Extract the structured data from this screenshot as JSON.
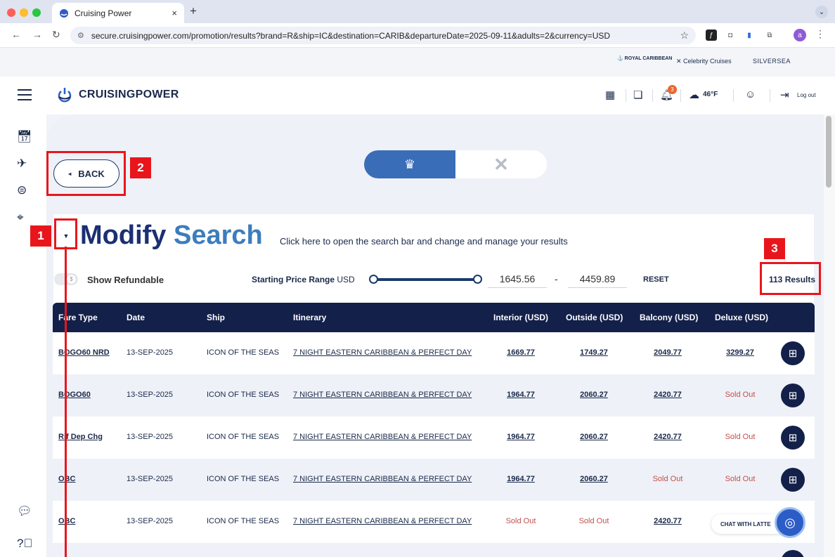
{
  "browser": {
    "tab_title": "Cruising Power",
    "tab_close": "×",
    "new_tab": "+",
    "tab_menu": "⌄",
    "url": "secure.cruisingpower.com/promotion/results?brand=R&ship=IC&destination=CARIB&departureDate=2025-09-11&adults=2&currency=USD",
    "profile_initial": "a"
  },
  "brands": [
    "ROYAL CARIBBEAN",
    "Celebrity Cruises",
    "SILVERSEA"
  ],
  "header": {
    "logo_text": "CRUISINGPOWER",
    "notification_count": "3",
    "temperature": "46°F",
    "logout_label": "Log out"
  },
  "back_button": {
    "label": "BACK"
  },
  "modify_search": {
    "title_part1": "Modify",
    "title_part2": "Search",
    "hint": "Click here to open the search bar and change and manage your results"
  },
  "filters": {
    "refundable_label": "Show Refundable",
    "price_label": "Starting Price Range",
    "price_currency": "USD",
    "price_min": "1645.56",
    "price_separator": "-",
    "price_max": "4459.89",
    "reset_label": "RESET",
    "results_count": "113 Results"
  },
  "table": {
    "headers": [
      "Fare Type",
      "Date",
      "Ship",
      "Itinerary",
      "Interior (USD)",
      "Outside (USD)",
      "Balcony (USD)",
      "Deluxe (USD)"
    ],
    "rows": [
      {
        "fare": "BOGO60 NRD",
        "date": "13-SEP-2025",
        "ship": "ICON OF THE SEAS",
        "itinerary": "7 NIGHT EASTERN CARIBBEAN & PERFECT DAY",
        "interior": "1669.77",
        "outside": "1749.27",
        "balcony": "2049.77",
        "deluxe": "3299.27"
      },
      {
        "fare": "BOGO60",
        "date": "13-SEP-2025",
        "ship": "ICON OF THE SEAS",
        "itinerary": "7 NIGHT EASTERN CARIBBEAN & PERFECT DAY",
        "interior": "1964.77",
        "outside": "2060.27",
        "balcony": "2420.77",
        "deluxe": "Sold Out"
      },
      {
        "fare": "Rif Dep Chg",
        "date": "13-SEP-2025",
        "ship": "ICON OF THE SEAS",
        "itinerary": "7 NIGHT EASTERN CARIBBEAN & PERFECT DAY",
        "interior": "1964.77",
        "outside": "2060.27",
        "balcony": "2420.77",
        "deluxe": "Sold Out"
      },
      {
        "fare": "OBC",
        "date": "13-SEP-2025",
        "ship": "ICON OF THE SEAS",
        "itinerary": "7 NIGHT EASTERN CARIBBEAN & PERFECT DAY",
        "interior": "1964.77",
        "outside": "2060.27",
        "balcony": "Sold Out",
        "deluxe": "Sold Out"
      },
      {
        "fare": "OBC",
        "date": "13-SEP-2025",
        "ship": "ICON OF THE SEAS",
        "itinerary": "7 NIGHT EASTERN CARIBBEAN & PERFECT DAY",
        "interior": "Sold Out",
        "outside": "Sold Out",
        "balcony": "2420.77",
        "deluxe": ""
      }
    ]
  },
  "chat": {
    "label": "CHAT WITH LATTE"
  },
  "annotations": [
    "1",
    "2",
    "3"
  ],
  "colors": {
    "brand_navy": "#13204a",
    "title_blue": "#3b7dbd",
    "sold_out_red": "#c0504d",
    "annotation_red": "#e8161c",
    "toggle_blue": "#3a6db8"
  }
}
